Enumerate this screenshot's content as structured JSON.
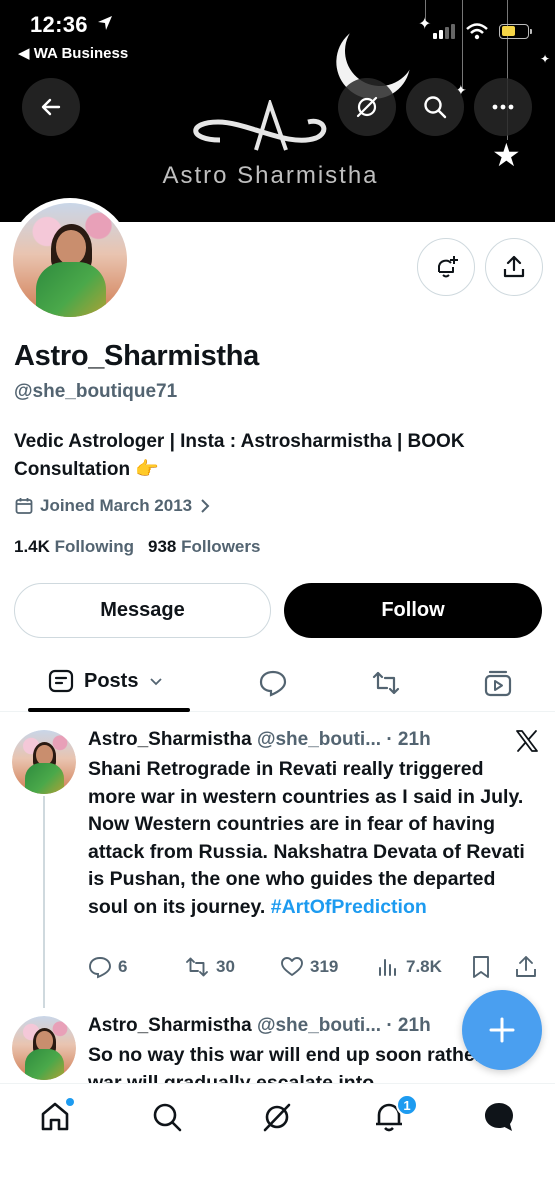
{
  "status_bar": {
    "time": "12:36",
    "back_app": "◀ WA Business"
  },
  "banner": {
    "logo_text": "Astro Sharmistha"
  },
  "profile": {
    "display_name": "Astro_Sharmistha",
    "handle": "@she_boutique71",
    "bio": "Vedic Astrologer | Insta : Astrosharmistha | BOOK Consultation 👉",
    "joined": "Joined March 2013",
    "following_count": "1.4K",
    "following_label": "Following",
    "followers_count": "938",
    "followers_label": "Followers"
  },
  "buttons": {
    "message": "Message",
    "follow": "Follow"
  },
  "tabs": {
    "posts": "Posts"
  },
  "tweets": [
    {
      "name": "Astro_Sharmistha",
      "handle_time": "@she_bouti... · 21h",
      "text": "Shani Retrograde in Revati really triggered more war in western countries as I said in July. Now Western countries are in fear of having attack from Russia. Nakshatra Devata of Revati is Pushan, the one who guides the departed soul on its journey.",
      "hashtag": "#ArtOfPrediction",
      "replies": "6",
      "retweets": "30",
      "likes": "319",
      "views": "7.8K"
    },
    {
      "name": "Astro_Sharmistha",
      "handle_time": "@she_bouti... · 21h",
      "text": "So no way this war will end up soon rather this war will gradually escalate into"
    }
  ],
  "bottom_nav": {
    "notifications_badge": "1"
  },
  "colors": {
    "accent": "#1d9bf0",
    "fab": "#4a9ff0",
    "secondary_text": "#536471"
  }
}
